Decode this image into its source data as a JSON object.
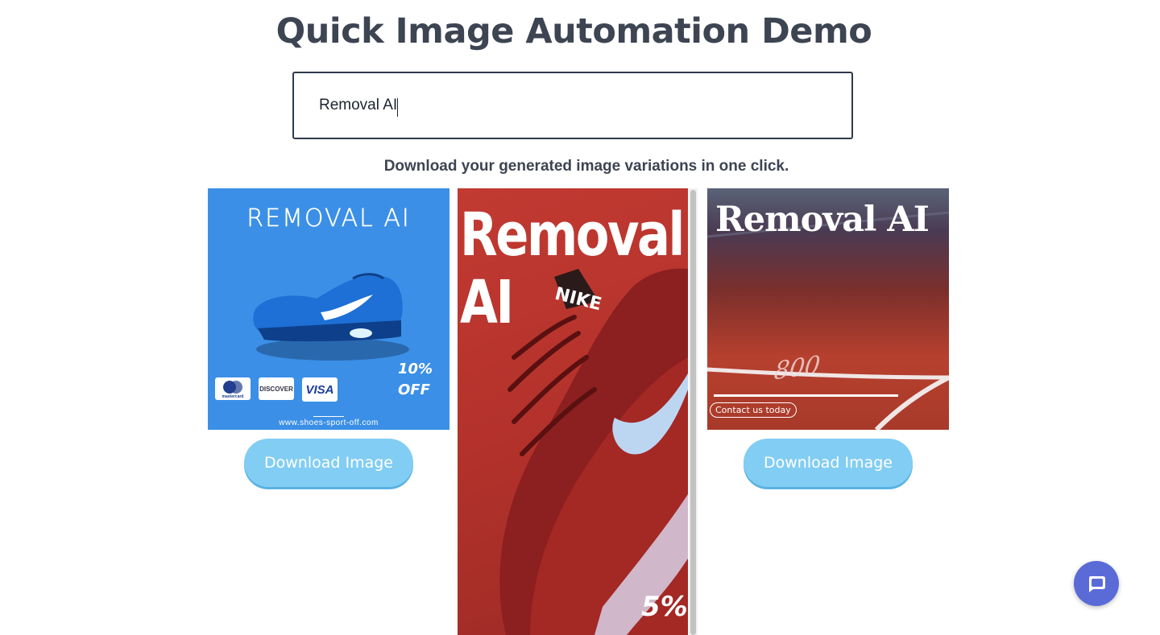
{
  "header": {
    "title": "Quick Image Automation Demo"
  },
  "search": {
    "value": "Removal AI"
  },
  "instructions": {
    "text": "Download your generated image variations in one click."
  },
  "cards": [
    {
      "headline": "REMOVAL AI",
      "discount_line1": "10%",
      "discount_line2": "OFF",
      "payment_cards": [
        "mastercard",
        "DISCOVER",
        "VISA"
      ],
      "url": "www.shoes-sport-off.com",
      "button_label": "Download Image"
    },
    {
      "headline_line1": "Removal",
      "headline_line2": "AI",
      "brand": "NIKE",
      "percent": "5%"
    },
    {
      "headline": "Removal AI",
      "track_number": "800",
      "contact_label": "Contact us today",
      "button_label": "Download Image"
    }
  ],
  "colors": {
    "title_text": "#3d4452",
    "card1_bg": "#3b8fe6",
    "button_bg": "#82cdf3",
    "chat_bg": "#5a6bd8"
  },
  "icons": {
    "chat": "chat-bubble-icon"
  }
}
